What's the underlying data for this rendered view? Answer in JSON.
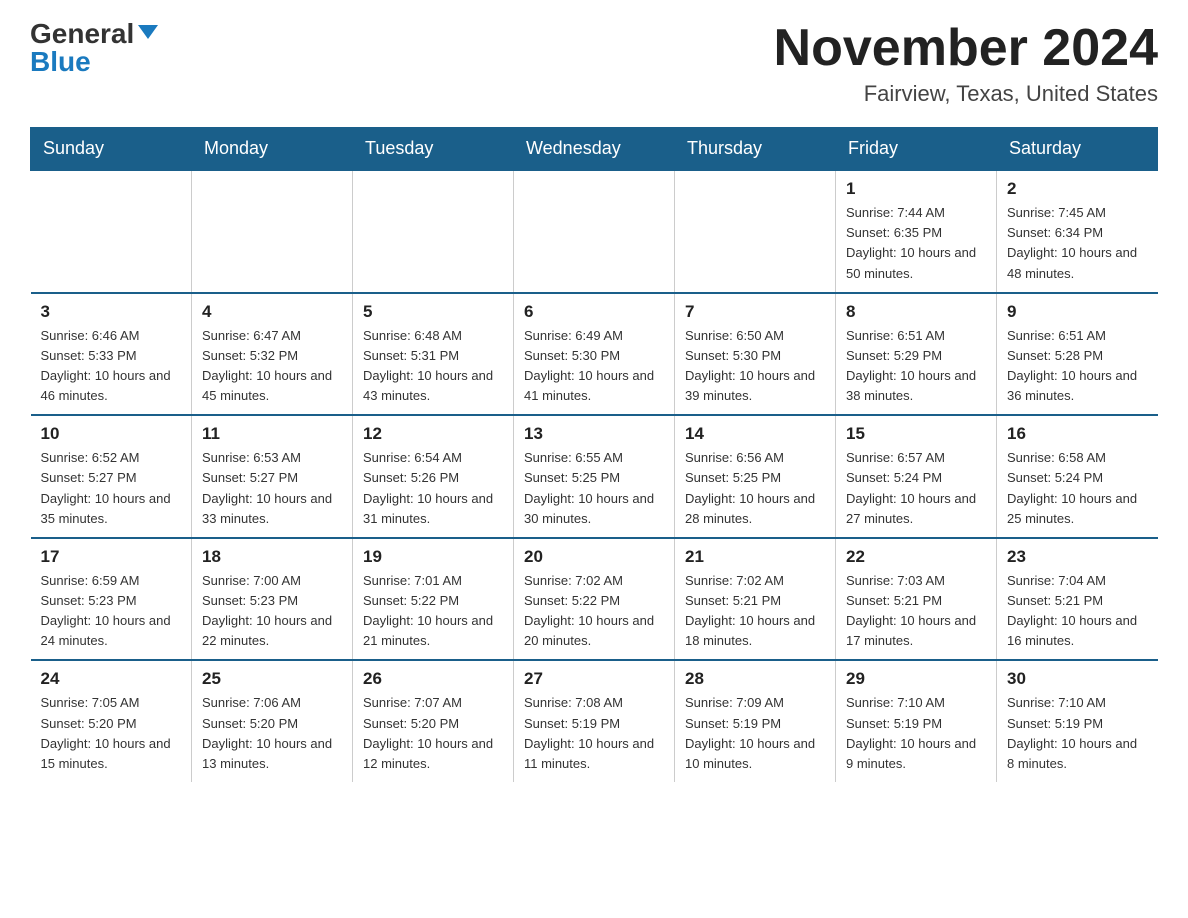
{
  "logo": {
    "general": "General",
    "blue": "Blue",
    "triangle": true
  },
  "title": "November 2024",
  "location": "Fairview, Texas, United States",
  "days_of_week": [
    "Sunday",
    "Monday",
    "Tuesday",
    "Wednesday",
    "Thursday",
    "Friday",
    "Saturday"
  ],
  "weeks": [
    [
      {
        "day": "",
        "info": ""
      },
      {
        "day": "",
        "info": ""
      },
      {
        "day": "",
        "info": ""
      },
      {
        "day": "",
        "info": ""
      },
      {
        "day": "",
        "info": ""
      },
      {
        "day": "1",
        "info": "Sunrise: 7:44 AM\nSunset: 6:35 PM\nDaylight: 10 hours and 50 minutes."
      },
      {
        "day": "2",
        "info": "Sunrise: 7:45 AM\nSunset: 6:34 PM\nDaylight: 10 hours and 48 minutes."
      }
    ],
    [
      {
        "day": "3",
        "info": "Sunrise: 6:46 AM\nSunset: 5:33 PM\nDaylight: 10 hours and 46 minutes."
      },
      {
        "day": "4",
        "info": "Sunrise: 6:47 AM\nSunset: 5:32 PM\nDaylight: 10 hours and 45 minutes."
      },
      {
        "day": "5",
        "info": "Sunrise: 6:48 AM\nSunset: 5:31 PM\nDaylight: 10 hours and 43 minutes."
      },
      {
        "day": "6",
        "info": "Sunrise: 6:49 AM\nSunset: 5:30 PM\nDaylight: 10 hours and 41 minutes."
      },
      {
        "day": "7",
        "info": "Sunrise: 6:50 AM\nSunset: 5:30 PM\nDaylight: 10 hours and 39 minutes."
      },
      {
        "day": "8",
        "info": "Sunrise: 6:51 AM\nSunset: 5:29 PM\nDaylight: 10 hours and 38 minutes."
      },
      {
        "day": "9",
        "info": "Sunrise: 6:51 AM\nSunset: 5:28 PM\nDaylight: 10 hours and 36 minutes."
      }
    ],
    [
      {
        "day": "10",
        "info": "Sunrise: 6:52 AM\nSunset: 5:27 PM\nDaylight: 10 hours and 35 minutes."
      },
      {
        "day": "11",
        "info": "Sunrise: 6:53 AM\nSunset: 5:27 PM\nDaylight: 10 hours and 33 minutes."
      },
      {
        "day": "12",
        "info": "Sunrise: 6:54 AM\nSunset: 5:26 PM\nDaylight: 10 hours and 31 minutes."
      },
      {
        "day": "13",
        "info": "Sunrise: 6:55 AM\nSunset: 5:25 PM\nDaylight: 10 hours and 30 minutes."
      },
      {
        "day": "14",
        "info": "Sunrise: 6:56 AM\nSunset: 5:25 PM\nDaylight: 10 hours and 28 minutes."
      },
      {
        "day": "15",
        "info": "Sunrise: 6:57 AM\nSunset: 5:24 PM\nDaylight: 10 hours and 27 minutes."
      },
      {
        "day": "16",
        "info": "Sunrise: 6:58 AM\nSunset: 5:24 PM\nDaylight: 10 hours and 25 minutes."
      }
    ],
    [
      {
        "day": "17",
        "info": "Sunrise: 6:59 AM\nSunset: 5:23 PM\nDaylight: 10 hours and 24 minutes."
      },
      {
        "day": "18",
        "info": "Sunrise: 7:00 AM\nSunset: 5:23 PM\nDaylight: 10 hours and 22 minutes."
      },
      {
        "day": "19",
        "info": "Sunrise: 7:01 AM\nSunset: 5:22 PM\nDaylight: 10 hours and 21 minutes."
      },
      {
        "day": "20",
        "info": "Sunrise: 7:02 AM\nSunset: 5:22 PM\nDaylight: 10 hours and 20 minutes."
      },
      {
        "day": "21",
        "info": "Sunrise: 7:02 AM\nSunset: 5:21 PM\nDaylight: 10 hours and 18 minutes."
      },
      {
        "day": "22",
        "info": "Sunrise: 7:03 AM\nSunset: 5:21 PM\nDaylight: 10 hours and 17 minutes."
      },
      {
        "day": "23",
        "info": "Sunrise: 7:04 AM\nSunset: 5:21 PM\nDaylight: 10 hours and 16 minutes."
      }
    ],
    [
      {
        "day": "24",
        "info": "Sunrise: 7:05 AM\nSunset: 5:20 PM\nDaylight: 10 hours and 15 minutes."
      },
      {
        "day": "25",
        "info": "Sunrise: 7:06 AM\nSunset: 5:20 PM\nDaylight: 10 hours and 13 minutes."
      },
      {
        "day": "26",
        "info": "Sunrise: 7:07 AM\nSunset: 5:20 PM\nDaylight: 10 hours and 12 minutes."
      },
      {
        "day": "27",
        "info": "Sunrise: 7:08 AM\nSunset: 5:19 PM\nDaylight: 10 hours and 11 minutes."
      },
      {
        "day": "28",
        "info": "Sunrise: 7:09 AM\nSunset: 5:19 PM\nDaylight: 10 hours and 10 minutes."
      },
      {
        "day": "29",
        "info": "Sunrise: 7:10 AM\nSunset: 5:19 PM\nDaylight: 10 hours and 9 minutes."
      },
      {
        "day": "30",
        "info": "Sunrise: 7:10 AM\nSunset: 5:19 PM\nDaylight: 10 hours and 8 minutes."
      }
    ]
  ]
}
